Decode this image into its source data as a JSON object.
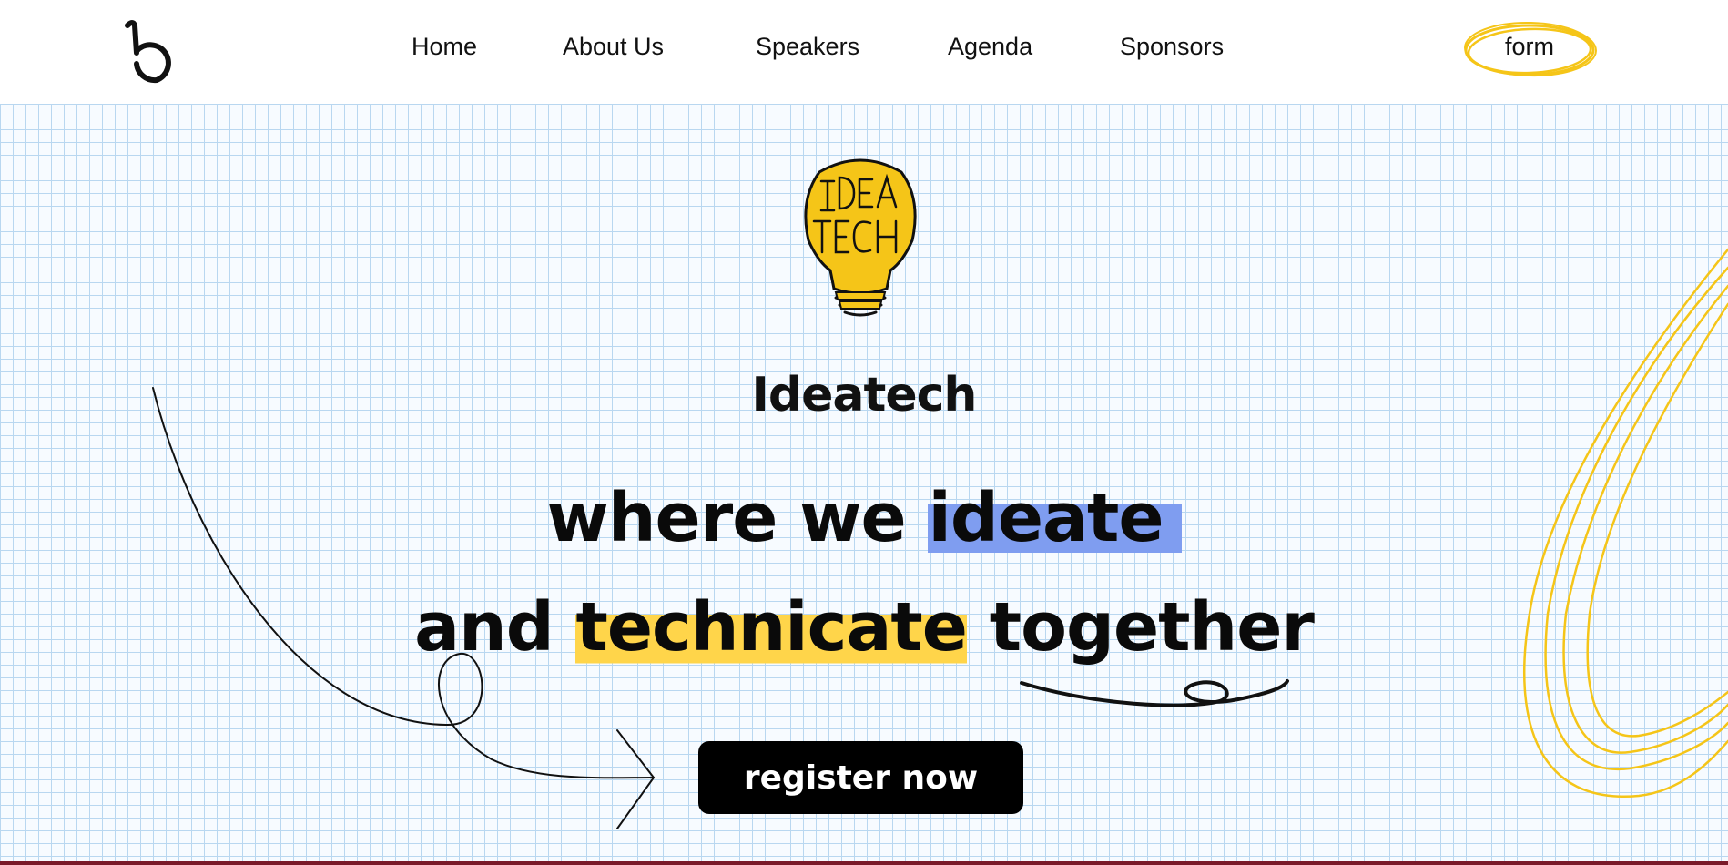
{
  "nav": {
    "links": [
      "Home",
      "About Us",
      "Speakers",
      "Agenda",
      "Sponsors"
    ],
    "form_label": "form"
  },
  "hero": {
    "brand": "Ideatech",
    "logo_art_text": "IDEA TECH",
    "headline": {
      "line1_prefix": "where we ",
      "line1_highlight": "ideate",
      "line2_prefix": "and ",
      "line2_highlight": "technicate",
      "line2_suffix": " together"
    },
    "cta": "register now"
  },
  "colors": {
    "accent_yellow": "#f5c518",
    "highlight_blue": "#7f9df0",
    "highlight_yellow": "#ffd54a",
    "grid_line": "#b9d7f0",
    "cta_background": "#000000"
  },
  "icons": [
    "brand-logo-icon",
    "lightbulb-logo",
    "curved-arrow-doodle",
    "underline-swirl-doodle",
    "yellow-loop-doodle",
    "scribble-circle-icon"
  ]
}
